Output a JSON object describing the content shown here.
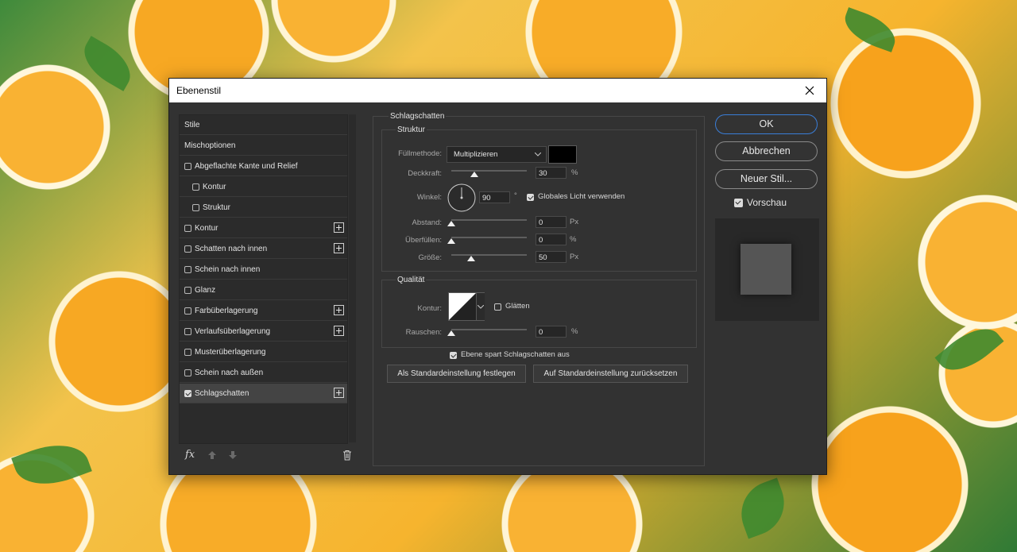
{
  "dialog": {
    "title": "Ebenenstil",
    "style_list": [
      {
        "label": "Stile",
        "checkbox": false
      },
      {
        "label": "Mischoptionen",
        "checkbox": false
      },
      {
        "label": "Abgeflachte Kante und Relief",
        "checkbox": true,
        "checked": false
      },
      {
        "label": "Kontur",
        "checkbox": true,
        "checked": false,
        "indent": true
      },
      {
        "label": "Struktur",
        "checkbox": true,
        "checked": false,
        "indent": true
      },
      {
        "label": "Kontur",
        "checkbox": true,
        "checked": false,
        "plus": true
      },
      {
        "label": "Schatten nach innen",
        "checkbox": true,
        "checked": false,
        "plus": true
      },
      {
        "label": "Schein nach innen",
        "checkbox": true,
        "checked": false
      },
      {
        "label": "Glanz",
        "checkbox": true,
        "checked": false
      },
      {
        "label": "Farbüberlagerung",
        "checkbox": true,
        "checked": false,
        "plus": true
      },
      {
        "label": "Verlaufsüberlagerung",
        "checkbox": true,
        "checked": false,
        "plus": true
      },
      {
        "label": "Musterüberlagerung",
        "checkbox": true,
        "checked": false
      },
      {
        "label": "Schein nach außen",
        "checkbox": true,
        "checked": false
      },
      {
        "label": "Schlagschatten",
        "checkbox": true,
        "checked": true,
        "plus": true,
        "selected": true
      }
    ],
    "bottom": {
      "fx": "fx"
    },
    "panel": {
      "title": "Schlagschatten",
      "struktur": {
        "title": "Struktur",
        "fuellmethode_label": "Füllmethode:",
        "fuellmethode_value": "Multiplizieren",
        "shadow_color": "#000000",
        "deckkraft_label": "Deckkraft:",
        "deckkraft_value": "30",
        "deckkraft_unit": "%",
        "deckkraft_fraction": 0.3,
        "winkel_label": "Winkel:",
        "winkel_value": "90",
        "winkel_unit": "°",
        "global_light_label": "Globales Licht verwenden",
        "global_light_checked": true,
        "abstand_label": "Abstand:",
        "abstand_value": "0",
        "abstand_unit": "Px",
        "ueberfuellen_label": "Überfüllen:",
        "ueberfuellen_value": "0",
        "ueberfuellen_unit": "%",
        "groesse_label": "Größe:",
        "groesse_value": "50",
        "groesse_unit": "Px"
      },
      "qualitaet": {
        "title": "Qualität",
        "kontur_label": "Kontur:",
        "glaetten_label": "Glätten",
        "glaetten_checked": false,
        "rauschen_label": "Rauschen:",
        "rauschen_value": "0",
        "rauschen_unit": "%"
      },
      "ebene_label": "Ebene spart Schlagschatten aus",
      "ebene_checked": true,
      "btn_default_set": "Als Standardeinstellung festlegen",
      "btn_default_reset": "Auf Standardeinstellung zurücksetzen"
    },
    "buttons": {
      "ok": "OK",
      "cancel": "Abbrechen",
      "new_style": "Neuer Stil...",
      "preview_label": "Vorschau",
      "preview_checked": true
    },
    "colors": {
      "accent": "#3a7ed8",
      "dialog_bg": "#323232"
    }
  }
}
